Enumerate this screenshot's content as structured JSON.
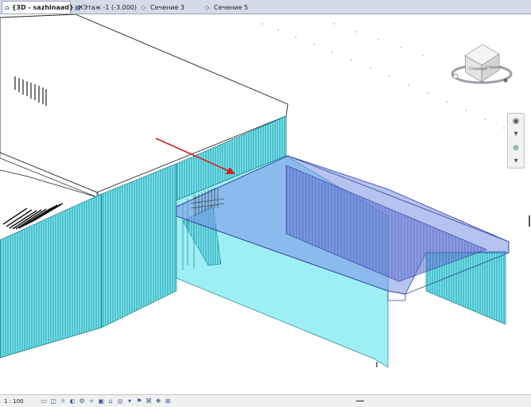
{
  "tabs": [
    {
      "label": "{3D - sazhinaad}",
      "icon": "3d-view-icon",
      "active": true,
      "close": "✕"
    },
    {
      "label": "Этаж -1 (-3.000)",
      "icon": "floor-plan-icon",
      "active": false
    },
    {
      "label": "Сечение 3",
      "icon": "section-icon",
      "active": false
    },
    {
      "label": "Сечение 5",
      "icon": "section-icon",
      "active": false
    }
  ],
  "viewcube": {
    "faces": {
      "front": "Спереди",
      "right": "Справа",
      "top": "Сверху"
    }
  },
  "statusbar": {
    "scale": "1 : 100"
  },
  "colors": {
    "tab_bar": "#d6dbe9",
    "wall_fill": "#7ce6ef",
    "wall_hatch": "#0d8796",
    "slab_fill": "#7a8fe4",
    "slab_edge": "#2d3f9a",
    "arrow": "#d22020"
  }
}
